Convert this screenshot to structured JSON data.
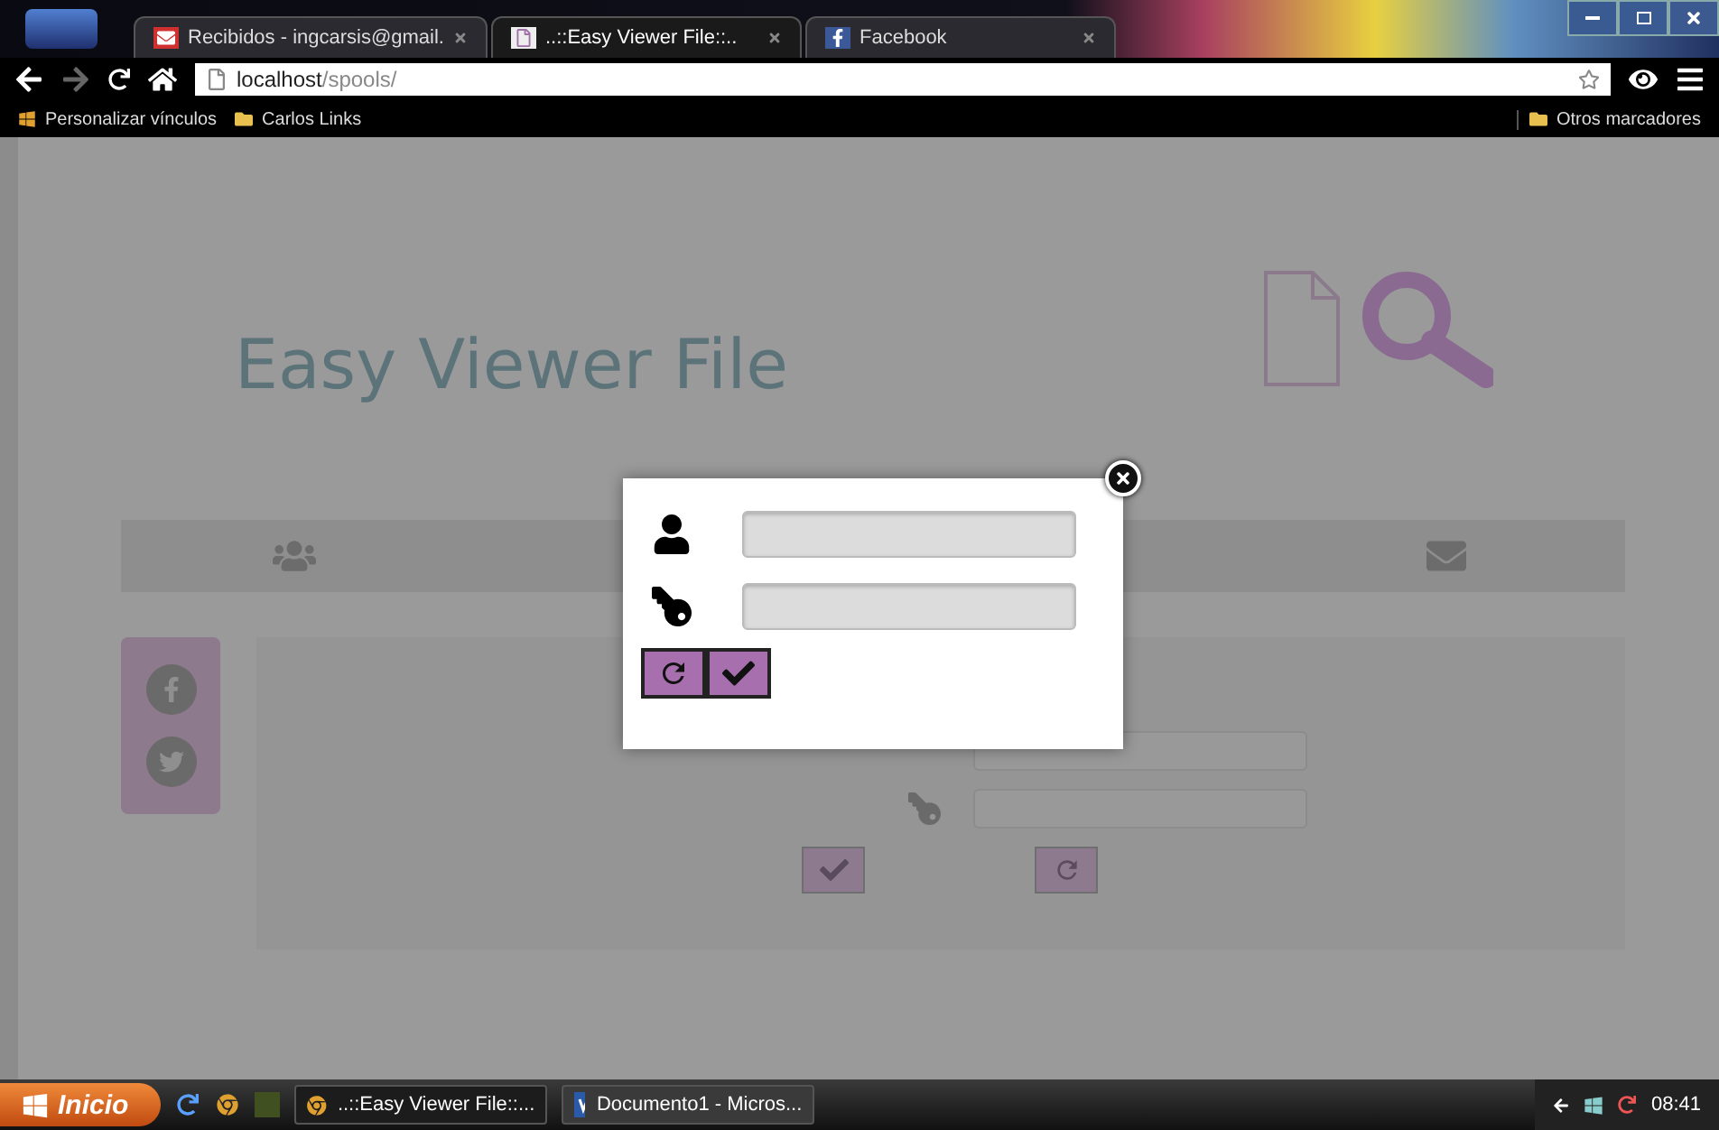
{
  "browser": {
    "tabs": [
      {
        "title": "Recibidos - ingcarsis@gmail.",
        "kind": "mail",
        "selected": false
      },
      {
        "title": "..::Easy Viewer File::..",
        "kind": "viewer",
        "selected": true
      },
      {
        "title": "Facebook",
        "kind": "facebook",
        "selected": false
      }
    ],
    "address": {
      "host": "localhost",
      "path": "/spools/"
    },
    "bookmarks": [
      {
        "label": "Personalizar vínculos",
        "kind": "windows"
      },
      {
        "label": "Carlos Links",
        "kind": "folder"
      }
    ],
    "other_bookmarks": "Otros marcadores"
  },
  "page": {
    "title": "Easy Viewer File"
  },
  "login_modal": {
    "fields": [
      {
        "kind": "user"
      },
      {
        "kind": "key"
      }
    ]
  },
  "taskbar": {
    "start": "Inicio",
    "tasks": [
      {
        "label": "..::Easy Viewer File::...",
        "kind": "chrome",
        "selected": true
      },
      {
        "label": "Documento1 - Micros...",
        "kind": "word",
        "selected": false
      }
    ],
    "clock": "08:41"
  }
}
